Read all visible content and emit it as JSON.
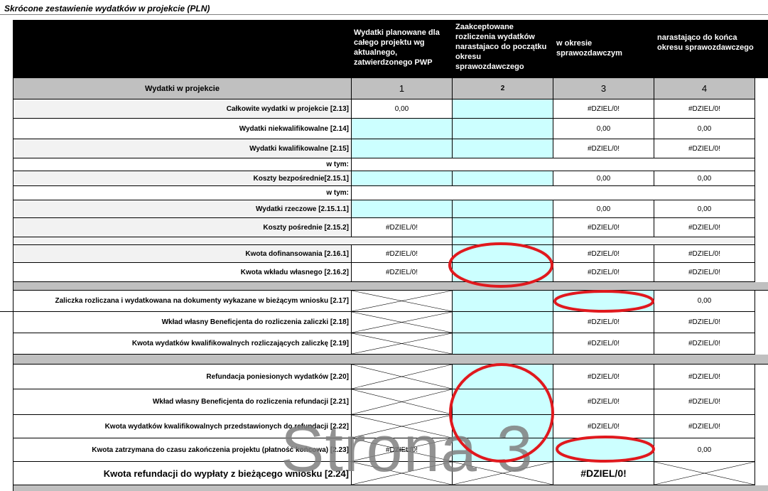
{
  "title": "Skrócone zestawienie wydatków w projekcie (PLN)",
  "header": {
    "col1": "Wydatki planowane dla całego projektu wg aktualnego, zatwierdzonego PWP",
    "col2": "Zaakceptowane rozliczenia wydatków narastajaco do początku okresu sprawozdawczego",
    "col3": "w okresie sprawozdawczym",
    "col4": "narastająco do końca okresu sprawozdawczego"
  },
  "numbers_row": {
    "label": "Wydatki w projekcie",
    "n1": "1",
    "n2": "2",
    "n3": "3",
    "n4": "4"
  },
  "rows": {
    "r1": {
      "label": "Całkowite wydatki w projekcie [2.13]",
      "c1": "0,00",
      "c3": "#DZIEL/0!",
      "c4": "#DZIEL/0!"
    },
    "r2": {
      "label": "Wydatki niekwalifikowalne [2.14]",
      "c3": "0,00",
      "c4": "0,00"
    },
    "r3": {
      "label": "Wydatki kwalifikowalne [2.15]",
      "c3": "#DZIEL/0!",
      "c4": "#DZIEL/0!"
    },
    "r4": {
      "label": "w tym:"
    },
    "r5": {
      "label": "Koszty bezpośrednie[2.15.1]",
      "c3": "0,00",
      "c4": "0,00"
    },
    "r6": {
      "label": "w tym:"
    },
    "r7": {
      "label": "Wydatki rzeczowe [2.15.1.1]",
      "c3": "0,00",
      "c4": "0,00"
    },
    "r8": {
      "label": "Koszty pośrednie [2.15.2]",
      "c1": "#DZIEL/0!",
      "c3": "#DZIEL/0!",
      "c4": "#DZIEL/0!"
    },
    "r9": {
      "label": "Kwota dofinansowania [2.16.1]",
      "c1": "#DZIEL/0!",
      "c3": "#DZIEL/0!",
      "c4": "#DZIEL/0!"
    },
    "r10": {
      "label": "Kwota wkładu własnego [2.16.2]",
      "c1": "#DZIEL/0!",
      "c3": "#DZIEL/0!",
      "c4": "#DZIEL/0!"
    },
    "r11": {
      "label": "Zaliczka rozliczana i wydatkowana na dokumenty wykazane w bieżącym wniosku [2.17]",
      "c4": "0,00"
    },
    "r12": {
      "label": "Wkład własny Beneficjenta do rozliczenia zaliczki [2.18]",
      "c3": "#DZIEL/0!",
      "c4": "#DZIEL/0!"
    },
    "r13": {
      "label": "Kwota wydatków kwalifikowalnych rozliczających zaliczkę [2.19]",
      "c3": "#DZIEL/0!",
      "c4": "#DZIEL/0!"
    },
    "r14": {
      "label": "Refundacja poniesionych wydatków  [2.20]",
      "c3": "#DZIEL/0!",
      "c4": "#DZIEL/0!"
    },
    "r15": {
      "label": "Wkład własny Beneficjenta do rozliczenia refundacji [2.21]",
      "c3": "#DZIEL/0!",
      "c4": "#DZIEL/0!"
    },
    "r16": {
      "label": "Kwota wydatków kwalifikowalnych przedstawionych do refundacji [2.22]",
      "c3": "#DZIEL/0!",
      "c4": "#DZIEL/0!"
    },
    "r17": {
      "label": "Kwota zatrzymana do czasu zakończenia projektu (płatność końcowa) [2.23]",
      "c1": "#DZIEL/0!",
      "c4": "0,00"
    },
    "r18": {
      "label": "Kwota refundacji do wypłaty z bieżącego wniosku [2.24]",
      "c3": "#DZIEL/0!"
    }
  },
  "watermark": "Strona 3",
  "colors": {
    "cyan": "#ccffff",
    "gray": "#c0c0c0",
    "black": "#000000",
    "circle": "#e0191e"
  }
}
